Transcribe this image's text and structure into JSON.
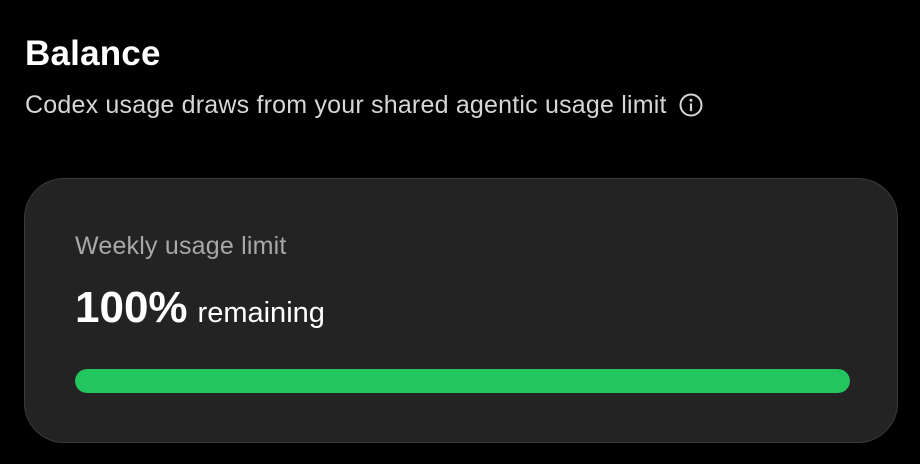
{
  "balance": {
    "title": "Balance",
    "subtitle": "Codex usage draws from your shared agentic usage limit",
    "info_icon": "info-circle-icon"
  },
  "weekly_limit": {
    "label": "Weekly usage limit",
    "percent_text": "100%",
    "suffix": "remaining",
    "remaining_fraction": 1.0,
    "bar_color": "#22c55e"
  }
}
